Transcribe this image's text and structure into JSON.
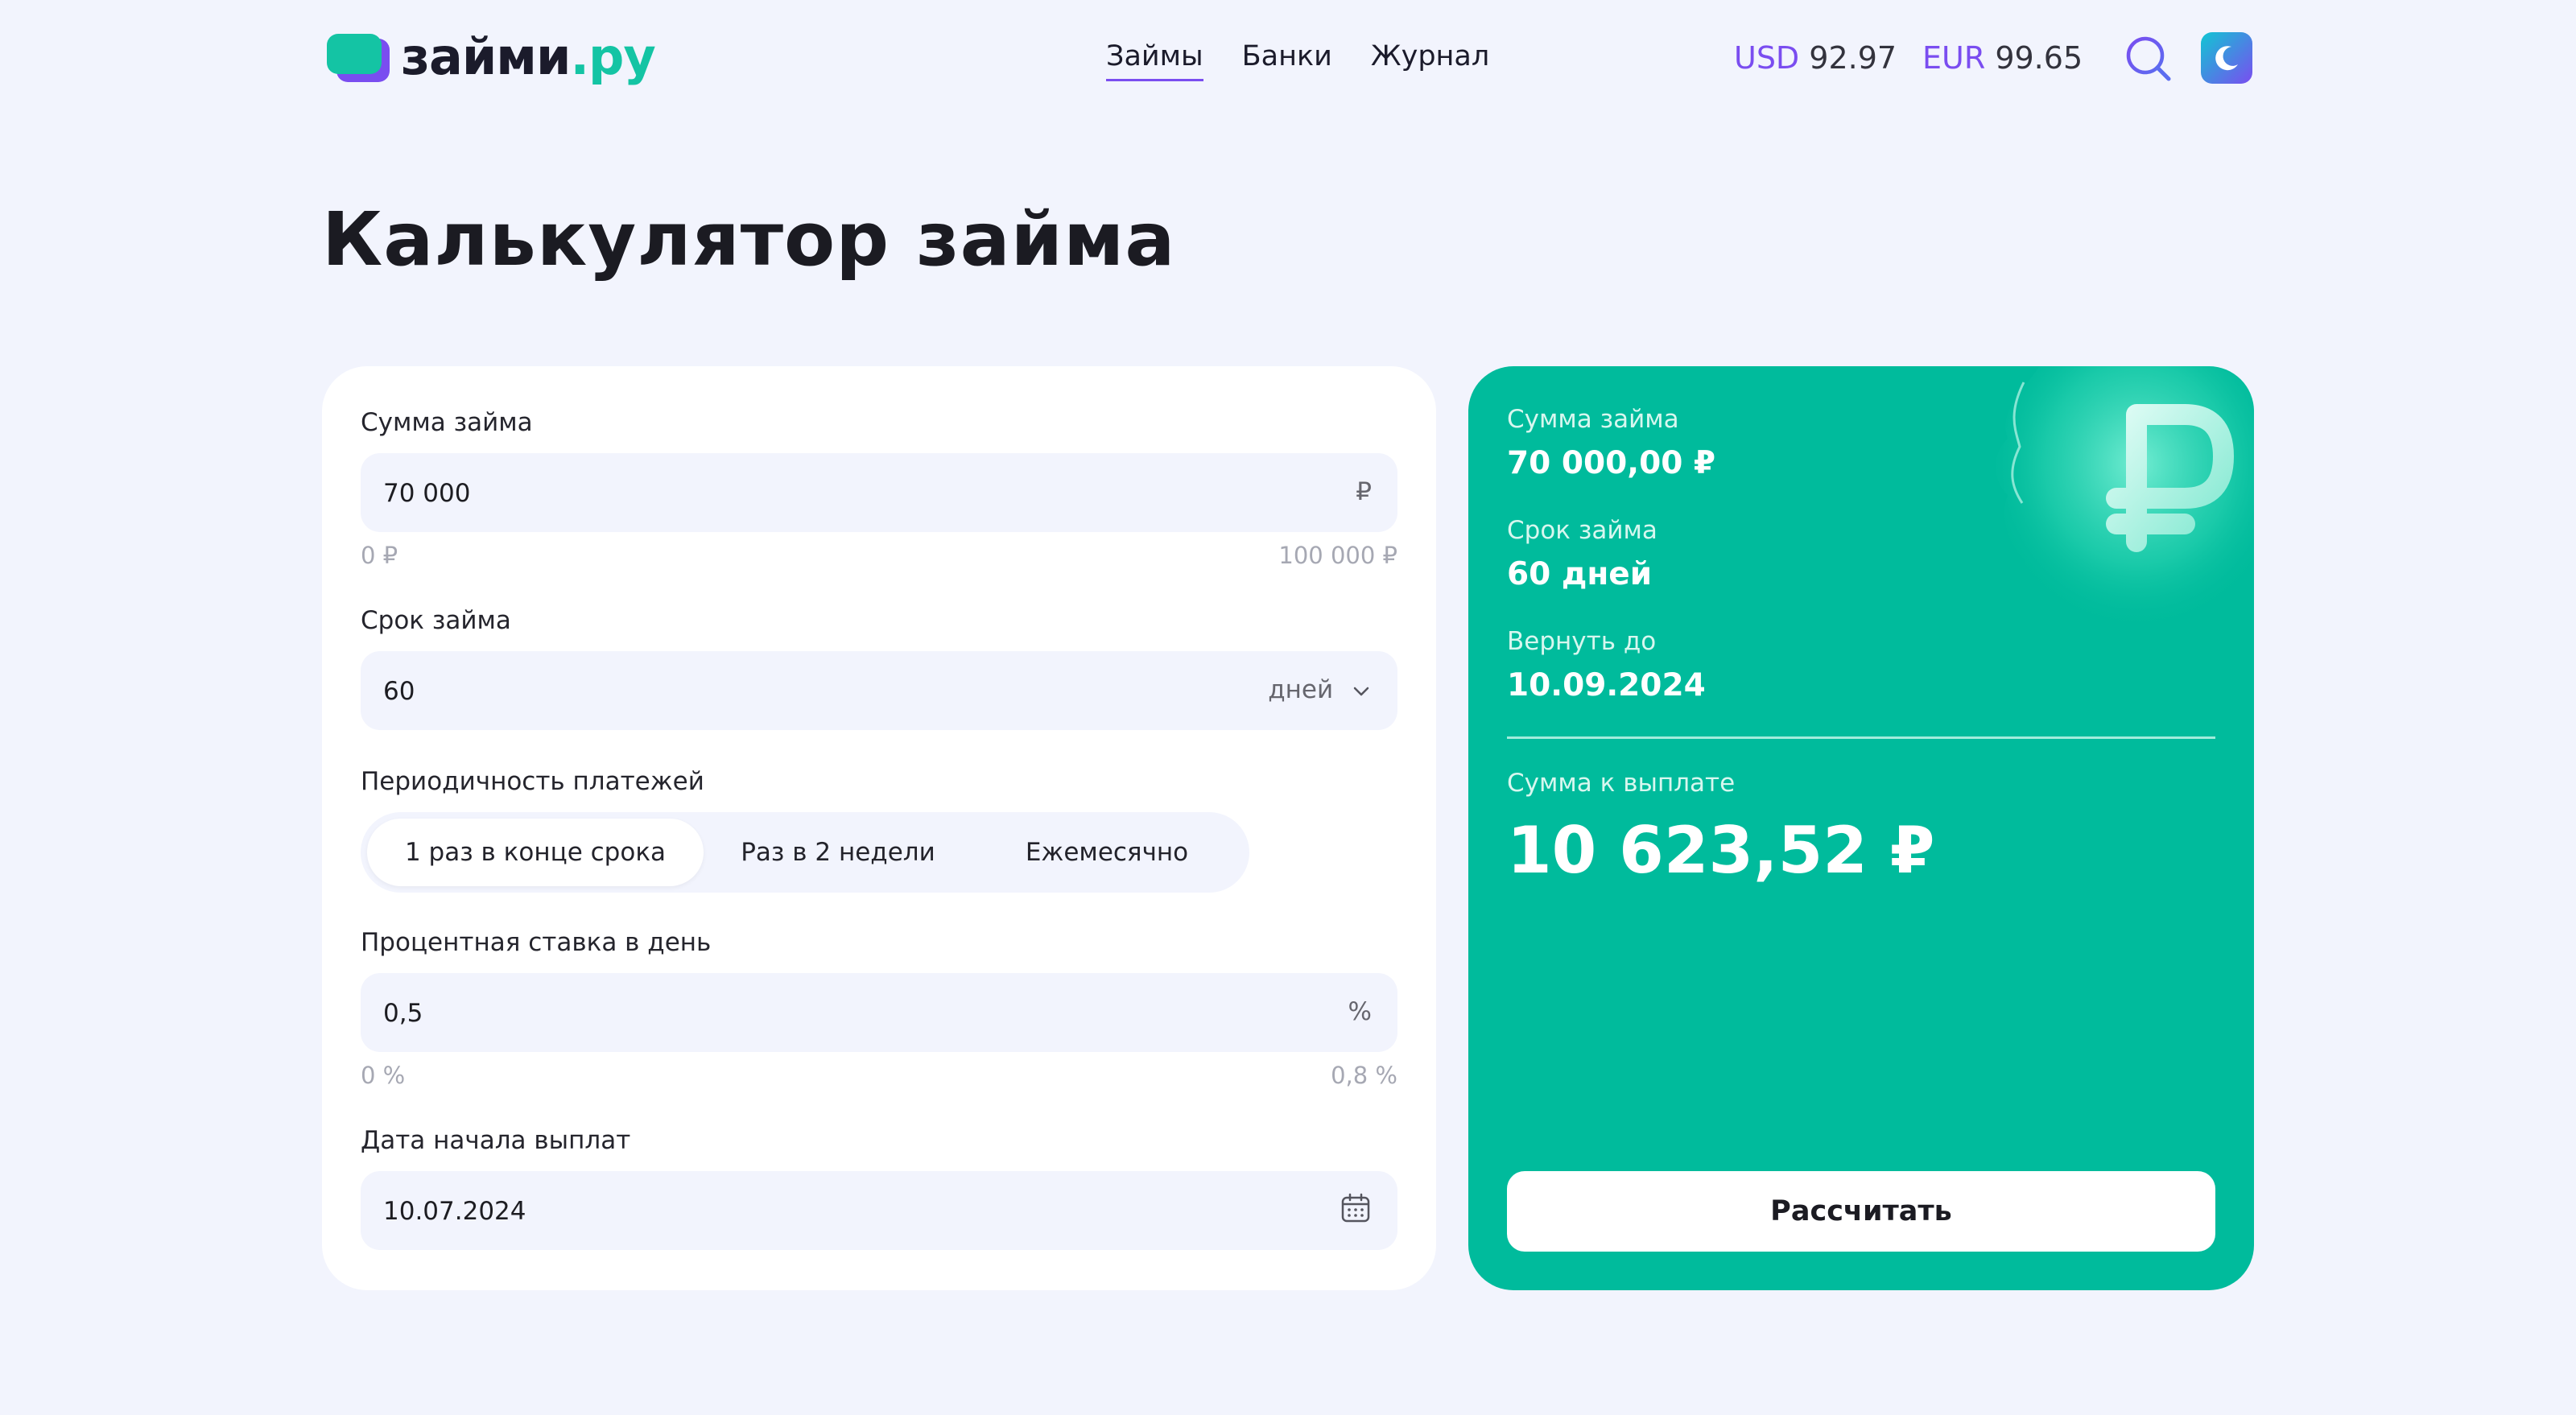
{
  "header": {
    "logo": {
      "main": "займи",
      "accent": ".ру"
    },
    "nav": [
      {
        "label": "Займы",
        "active": true
      },
      {
        "label": "Банки",
        "active": false
      },
      {
        "label": "Журнал",
        "active": false
      }
    ],
    "rates": {
      "usd": {
        "code": "USD",
        "value": "92.97"
      },
      "eur": {
        "code": "EUR",
        "value": "99.65"
      }
    },
    "icons": {
      "search": "search-icon",
      "theme": "moon-icon"
    }
  },
  "page": {
    "title": "Калькулятор займа"
  },
  "form": {
    "amount": {
      "label": "Сумма займа",
      "value": "70 000",
      "suffix": "₽",
      "min": "0 ₽",
      "max": "100 000 ₽"
    },
    "term": {
      "label": "Срок займа",
      "value": "60",
      "unit": "дней"
    },
    "frequency": {
      "label": "Периодичность платежей",
      "options": [
        "1 раз в конце срока",
        "Раз в 2 недели",
        "Ежемесячно"
      ],
      "selected": "1 раз в конце срока"
    },
    "rate": {
      "label": "Процентная ставка в день",
      "value": "0,5",
      "suffix": "%",
      "min": "0 %",
      "max": "0,8 %"
    },
    "start_date": {
      "label": "Дата начала выплат",
      "value": "10.07.2024",
      "icon": "calendar-icon"
    }
  },
  "result": {
    "amount_label": "Сумма займа",
    "amount_value": "70 000,00 ₽",
    "term_label": "Срок займа",
    "term_value": "60 дней",
    "return_label": "Вернуть до",
    "return_value": "10.09.2024",
    "total_label": "Сумма к выплате",
    "total_value": "10 623,52 ₽",
    "button": "Рассчитать",
    "decoration_icon": "ruble-coin-icon"
  },
  "colors": {
    "accent": "#7a4df0",
    "brand": "#14c4a4",
    "result_bg": "#00bb9c",
    "page_bg": "#f2f4fd"
  }
}
